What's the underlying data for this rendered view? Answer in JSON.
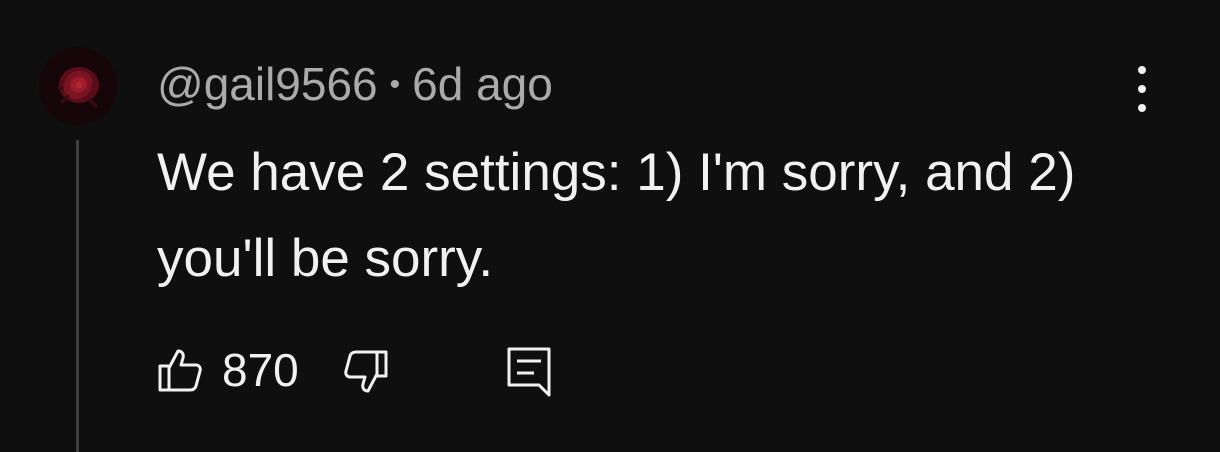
{
  "comment": {
    "author": "@gail9566",
    "separator": "•",
    "time": "6d ago",
    "text": "We have 2 settings: 1) I'm sorry, and 2) you'll be sorry.",
    "like_count": "870"
  },
  "icons": {
    "avatar": "avatar-image",
    "more": "more-vert-icon",
    "like": "thumbs-up-icon",
    "dislike": "thumbs-down-icon",
    "reply": "reply-comment-icon"
  },
  "colors": {
    "background": "#0f0f0f",
    "primary_text": "#f1f1f1",
    "secondary_text": "#aaaaaa",
    "thread_line": "#3f3f3f"
  }
}
